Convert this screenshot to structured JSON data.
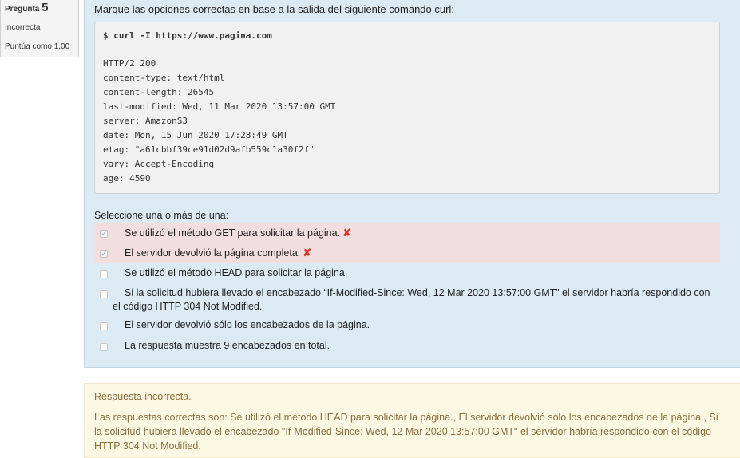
{
  "info": {
    "question_word": "Pregunta",
    "question_number": "5",
    "state": "Incorrecta",
    "grade": "Puntúa como 1,00"
  },
  "question": {
    "text": "Marque las opciones correctas en base a la salida del siguiente comando curl:",
    "code": {
      "command": "$ curl -I https://www.pagina.com",
      "output_lines": [
        "HTTP/2 200",
        "content-type: text/html",
        "content-length: 26545",
        "last-modified: Wed, 11 Mar 2020 13:57:00 GMT",
        "server: AmazonS3",
        "date: Mon, 15 Jun 2020 17:28:49 GMT",
        "etag: \"a61cbbf39ce91d02d9afb559c1a30f2f\"",
        "vary: Accept-Encoding",
        "age: 4590"
      ]
    },
    "prompt": "Seleccione una o más de una:",
    "options": [
      {
        "label": "Se utilizó el método GET para solicitar la página.",
        "checked": true,
        "result": "incorrect"
      },
      {
        "label": "El servidor devolvió la página completa.",
        "checked": true,
        "result": "incorrect"
      },
      {
        "label": "Se utilizó el método HEAD para solicitar la página.",
        "checked": false
      },
      {
        "label": "Si la solicitud hubiera llevado el encabezado “If-Modified-Since: Wed, 12 Mar 2020 13:57:00 GMT” el servidor habría respondido con el código HTTP 304 Not Modified.",
        "checked": false
      },
      {
        "label": "El servidor devolvió sólo los encabezados de la página.",
        "checked": false
      },
      {
        "label": "La respuesta muestra 9 encabezados en total.",
        "checked": false
      }
    ]
  },
  "feedback": {
    "title": "Respuesta incorrecta.",
    "body": "Las respuestas correctas son: Se utilizó el método HEAD para solicitar la página., El servidor devolvió sólo los encabezados de la página., Si la solicitud hubiera llevado el encabezado \"If-Modified-Since: Wed, 12 Mar 2020 13:57:00 GMT\" el servidor habría respondido con el código HTTP 304 Not Modified."
  },
  "colors": {
    "formulation_bg": "#dbeaf3",
    "incorrect_bg": "#f2dedf",
    "incorrect_mark": "#d9362b",
    "feedback_bg": "#fcf8e3",
    "feedback_text": "#8a6d3b"
  },
  "icons": {
    "incorrect": "cross-icon",
    "checked": "checkmark-icon"
  }
}
